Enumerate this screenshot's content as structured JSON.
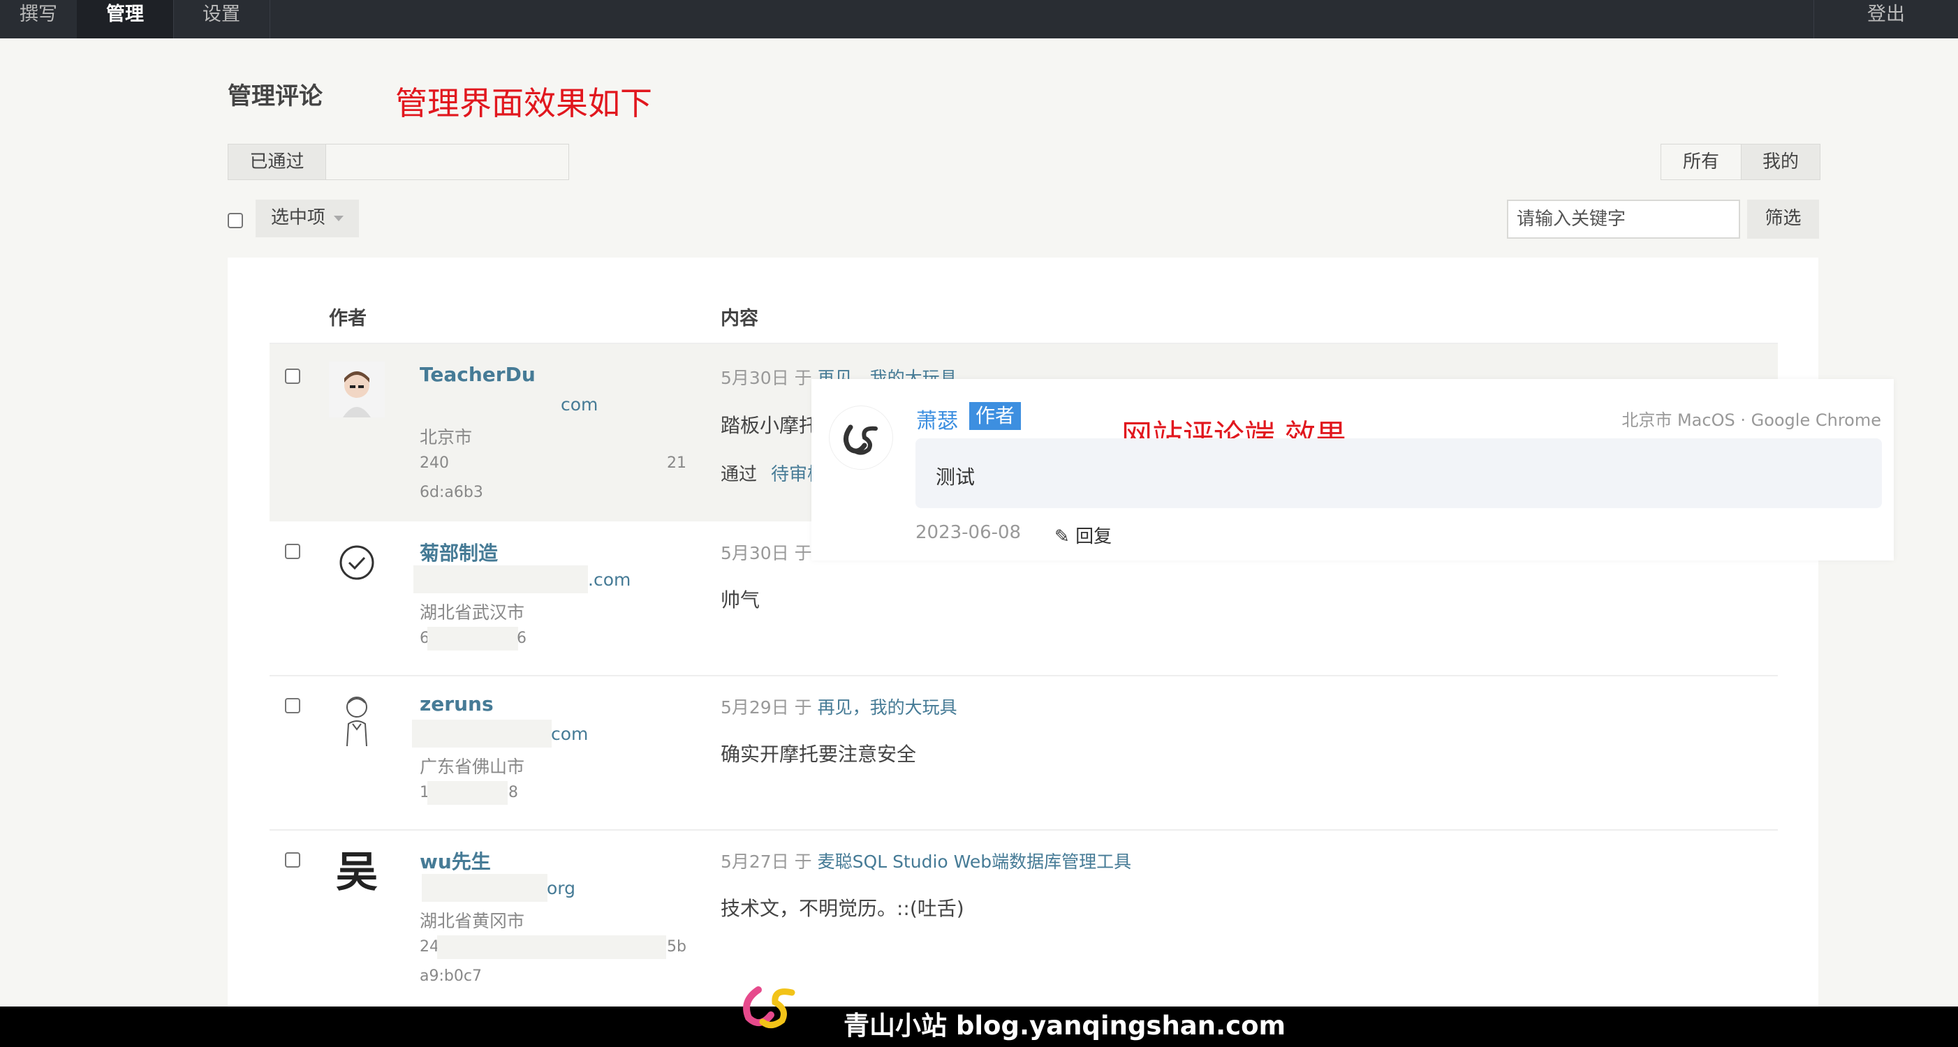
{
  "nav": {
    "items": [
      "撰写",
      "管理",
      "设置"
    ],
    "logout": "登出"
  },
  "page": {
    "title": "管理评论",
    "annotation_admin": "管理界面效果如下",
    "annotation_site": "网站评论端 效果"
  },
  "filters": {
    "status_tab": "已通过",
    "scope_all": "所有",
    "scope_mine": "我的",
    "bulk_select": "选中项",
    "search_placeholder": "请输入关键字",
    "filter_button": "筛选"
  },
  "table": {
    "headers": {
      "author": "作者",
      "content": "内容"
    },
    "rows": [
      {
        "author": "TeacherDu",
        "email_suffix": "com",
        "location": "北京市",
        "ip_line1_start": "240",
        "ip_line1_end": "21",
        "ip_line2": "6d:a6b3",
        "date": "5月30日",
        "prep": "于",
        "post": "再见，我的大玩具",
        "content": "踏板小摩托",
        "actions": [
          "通过",
          "待审核"
        ]
      },
      {
        "author": "菊部制造",
        "email_suffix": ".com",
        "location": "湖北省武汉市",
        "ip_start": "6",
        "ip_end": "6",
        "date": "5月30日",
        "prep": "于",
        "content": "帅气"
      },
      {
        "author": "zeruns",
        "email_suffix": "com",
        "location": "广东省佛山市",
        "ip_start": "1",
        "ip_end": "8",
        "date": "5月29日",
        "prep": "于",
        "post": "再见，我的大玩具",
        "content": "确实开摩托要注意安全"
      },
      {
        "author": "wu先生",
        "email_suffix": "org",
        "location": "湖北省黄冈市",
        "ip_line1_start": "24",
        "ip_line1_end": "5b",
        "ip_line2": "a9:b0c7",
        "date": "5月27日",
        "prep": "于",
        "post": "麦聪SQL Studio Web端数据库管理工具",
        "content": "技术文，不明觉历。::(吐舌)",
        "avatar_char": "吴"
      }
    ]
  },
  "site_comment": {
    "name": "萧瑟",
    "badge": "作者",
    "meta": "北京市 MacOS · Google Chrome",
    "text": "测试",
    "date": "2023-06-08",
    "reply": "回复"
  },
  "footer": {
    "text": "青山小站 blog.yanqingshan.com"
  },
  "colors": {
    "nav_bg": "#292d33",
    "link": "#467b96",
    "annotation": "#e1171e",
    "badge": "#3d8fe0"
  }
}
